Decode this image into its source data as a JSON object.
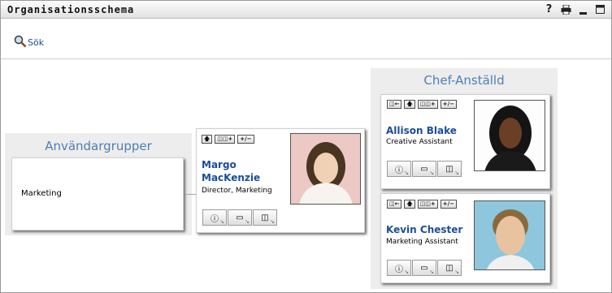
{
  "window": {
    "title": "Organisationsschema",
    "controls": [
      "?",
      "print",
      "minimize",
      "maximize"
    ]
  },
  "toolbar": {
    "search_label": "Sök"
  },
  "groups": {
    "title": "Användargrupper",
    "items": [
      "Marketing"
    ]
  },
  "selected_person": {
    "name_line1": "Margo",
    "name_line2": "MacKenzie",
    "role": "Director, Marketing"
  },
  "manager_employee": {
    "title": "Chef-Anställd",
    "people": [
      {
        "name": "Allison Blake",
        "role": "Creative Assistant"
      },
      {
        "name": "Kevin Chester",
        "role": "Marketing Assistant"
      }
    ]
  },
  "colors": {
    "link": "#1c4d9a",
    "section_title": "#4d7fb3",
    "panel_bg": "#ededed"
  }
}
